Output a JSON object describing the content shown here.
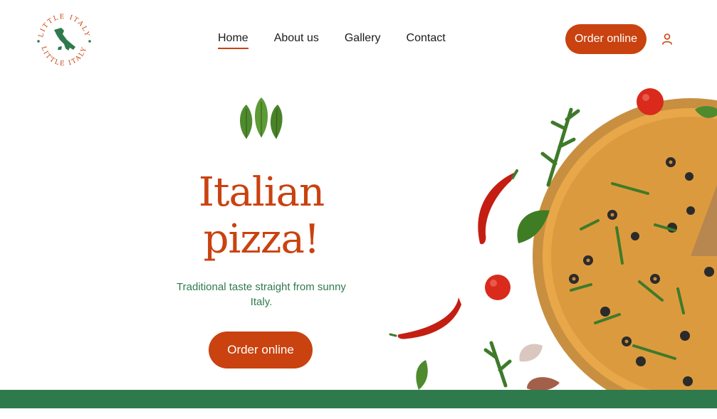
{
  "brand": {
    "logo_text_top": "LITTLE ITALY",
    "logo_text_bottom": "LITTLE ITALY",
    "colors": {
      "primary": "#c9420f",
      "green": "#2f7a4d",
      "text": "#1c1c1c"
    }
  },
  "nav": {
    "items": [
      {
        "label": "Home",
        "active": true
      },
      {
        "label": "About us",
        "active": false
      },
      {
        "label": "Gallery",
        "active": false
      },
      {
        "label": "Contact",
        "active": false
      }
    ]
  },
  "header": {
    "order_label": "Order online",
    "user_icon": "user-icon"
  },
  "hero": {
    "title_line1": "Italian",
    "title_line2": "pizza!",
    "subtitle": "Traditional taste straight from sunny Italy.",
    "order_label": "Order online"
  }
}
